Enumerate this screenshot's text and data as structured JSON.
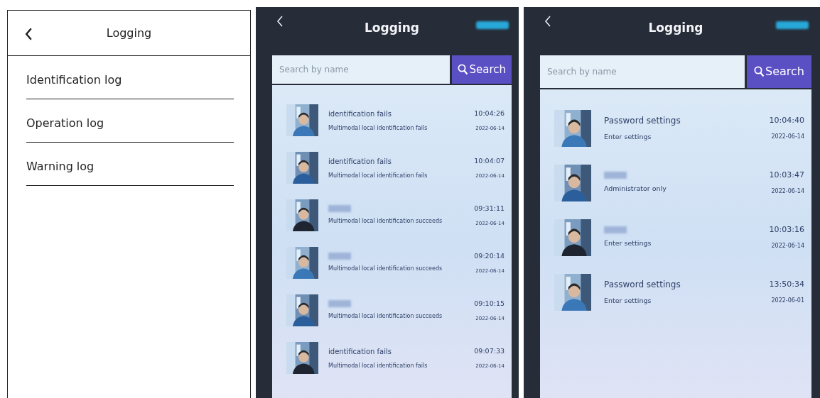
{
  "menu_screen": {
    "title": "Logging",
    "items": [
      {
        "label": "Identification log"
      },
      {
        "label": "Operation log"
      },
      {
        "label": "Warning log"
      }
    ]
  },
  "device_screens": [
    {
      "title": "Logging",
      "search": {
        "placeholder": "Search by name",
        "button": "Search"
      },
      "entries": [
        {
          "redacted": false,
          "title": "identification fails",
          "detail": "Multimodal local identification fails",
          "time": "10:04:26",
          "date": "2022-06-14"
        },
        {
          "redacted": false,
          "title": "identification fails",
          "detail": "Multimodal local identification fails",
          "time": "10:04:07",
          "date": "2022-06-14"
        },
        {
          "redacted": true,
          "detail": "Multimodal local identification succeeds",
          "time": "09:31:11",
          "date": "2022-06-14"
        },
        {
          "redacted": true,
          "detail": "Multimodal local identification succeeds",
          "time": "09:20:14",
          "date": "2022-06-14"
        },
        {
          "redacted": true,
          "detail": "Multimodal local identification succeeds",
          "time": "09:10:15",
          "date": "2022-06-14"
        },
        {
          "redacted": false,
          "title": "identification fails",
          "detail": "Multimodal local identification fails",
          "time": "09:07:33",
          "date": "2022-06-14"
        }
      ]
    },
    {
      "title": "Logging",
      "search": {
        "placeholder": "Search by name",
        "button": "Search"
      },
      "entries": [
        {
          "redacted": false,
          "title": "Password settings",
          "detail": "Enter settings",
          "time": "10:04:40",
          "date": "2022-06-14"
        },
        {
          "redacted": true,
          "detail": "Administrator only",
          "time": "10:03:47",
          "date": "2022-06-14"
        },
        {
          "redacted": true,
          "detail": "Enter settings",
          "time": "10:03:16",
          "date": "2022-06-14"
        },
        {
          "redacted": false,
          "title": "Password settings",
          "detail": "Enter settings",
          "time": "13:50:34",
          "date": "2022-06-01"
        }
      ]
    }
  ]
}
